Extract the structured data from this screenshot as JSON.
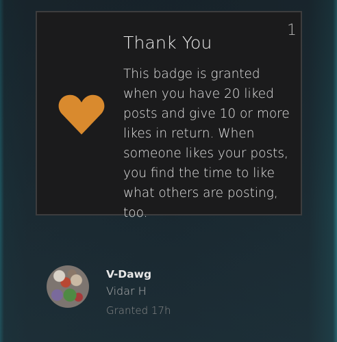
{
  "badge": {
    "count": "1",
    "title": "Thank You",
    "description": "This badge is granted when you have 20 liked posts and give 10 or more likes in return. When someone likes your posts, you find the time to like what others are posting, too.",
    "icon": "heart-icon",
    "icon_color": "#d98a2e"
  },
  "user": {
    "username": "V-Dawg",
    "full_name": "Vidar H",
    "granted": "Granted 17h"
  }
}
